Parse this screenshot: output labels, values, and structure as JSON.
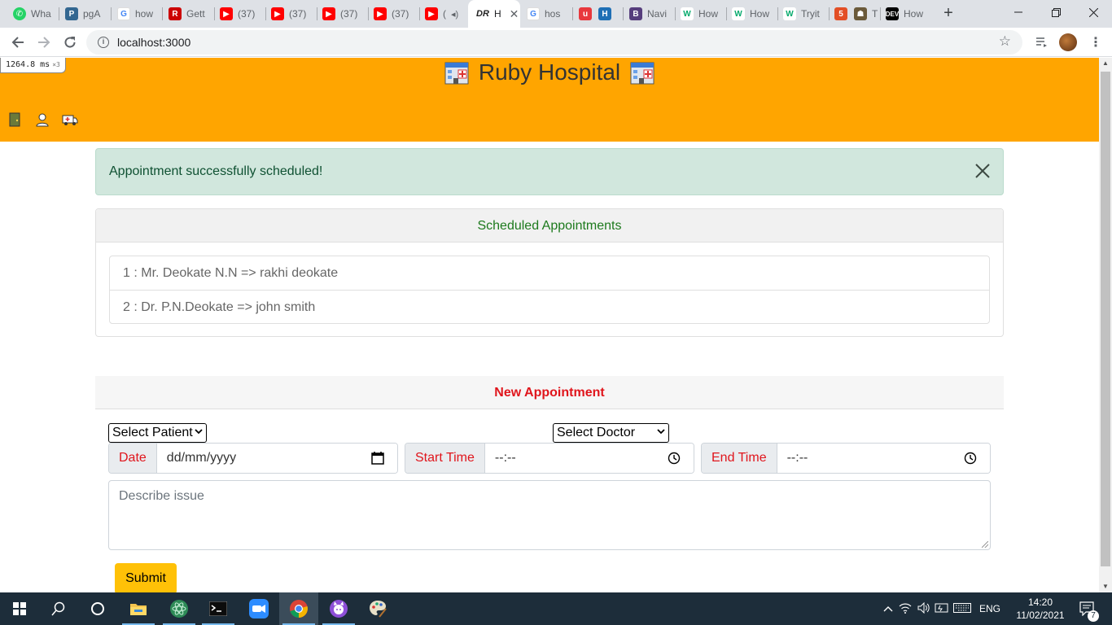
{
  "browser": {
    "tabs": [
      {
        "label": "Wha",
        "icon": "whatsapp-icon"
      },
      {
        "label": "pgA",
        "icon": "pgadmin-icon"
      },
      {
        "label": "how",
        "icon": "google-icon"
      },
      {
        "label": "Gett",
        "icon": "rails-icon"
      },
      {
        "label": "(37)",
        "icon": "youtube-icon"
      },
      {
        "label": "(37)",
        "icon": "youtube-icon"
      },
      {
        "label": "(37)",
        "icon": "youtube-icon"
      },
      {
        "label": "(37)",
        "icon": "youtube-icon"
      },
      {
        "label": "(",
        "icon": "youtube-icon"
      },
      {
        "label": "H",
        "icon": "devrant-icon",
        "active": true
      },
      {
        "label": "hos",
        "icon": "google-icon"
      },
      {
        "label": "",
        "icon": "ublock-icon"
      },
      {
        "label": "",
        "icon": "hospital-icon"
      },
      {
        "label": "Navi",
        "icon": "bootstrap-icon"
      },
      {
        "label": "How",
        "icon": "w3-icon"
      },
      {
        "label": "How",
        "icon": "w3-icon"
      },
      {
        "label": "Tryit",
        "icon": "w3-icon"
      },
      {
        "label": "",
        "icon": "html5-icon"
      },
      {
        "label": "T",
        "icon": "robot-icon"
      },
      {
        "label": "How",
        "icon": "dev-icon"
      }
    ],
    "new_tab": "+",
    "address": "localhost:3000"
  },
  "perf": {
    "time": "1264.8 ms",
    "multiplier": "×3"
  },
  "header": {
    "title": "Ruby Hospital"
  },
  "alert": {
    "message": "Appointment successfully scheduled!",
    "close": "×"
  },
  "appointments": {
    "title": "Scheduled Appointments",
    "items": [
      "1 : Mr. Deokate N.N => rakhi deokate",
      "2 : Dr. P.N.Deokate => john smith"
    ]
  },
  "form": {
    "title": "New Appointment",
    "patient_select": "Select Patient",
    "doctor_select": "Select Doctor",
    "date_label": "Date",
    "date_value": "dd/mm/yyyy",
    "start_label": "Start Time",
    "start_value": "--:--",
    "end_label": "End Time",
    "end_value": "--:--",
    "description_placeholder": "Describe issue",
    "submit": "Submit"
  },
  "taskbar": {
    "language": "ENG",
    "time": "14:20",
    "date": "11/02/2021",
    "notifications": "7"
  },
  "colors": {
    "header_bg": "#ffa500",
    "alert_bg": "#d1e7dd",
    "accent_red": "#e0151c",
    "submit_bg": "#ffc107"
  }
}
